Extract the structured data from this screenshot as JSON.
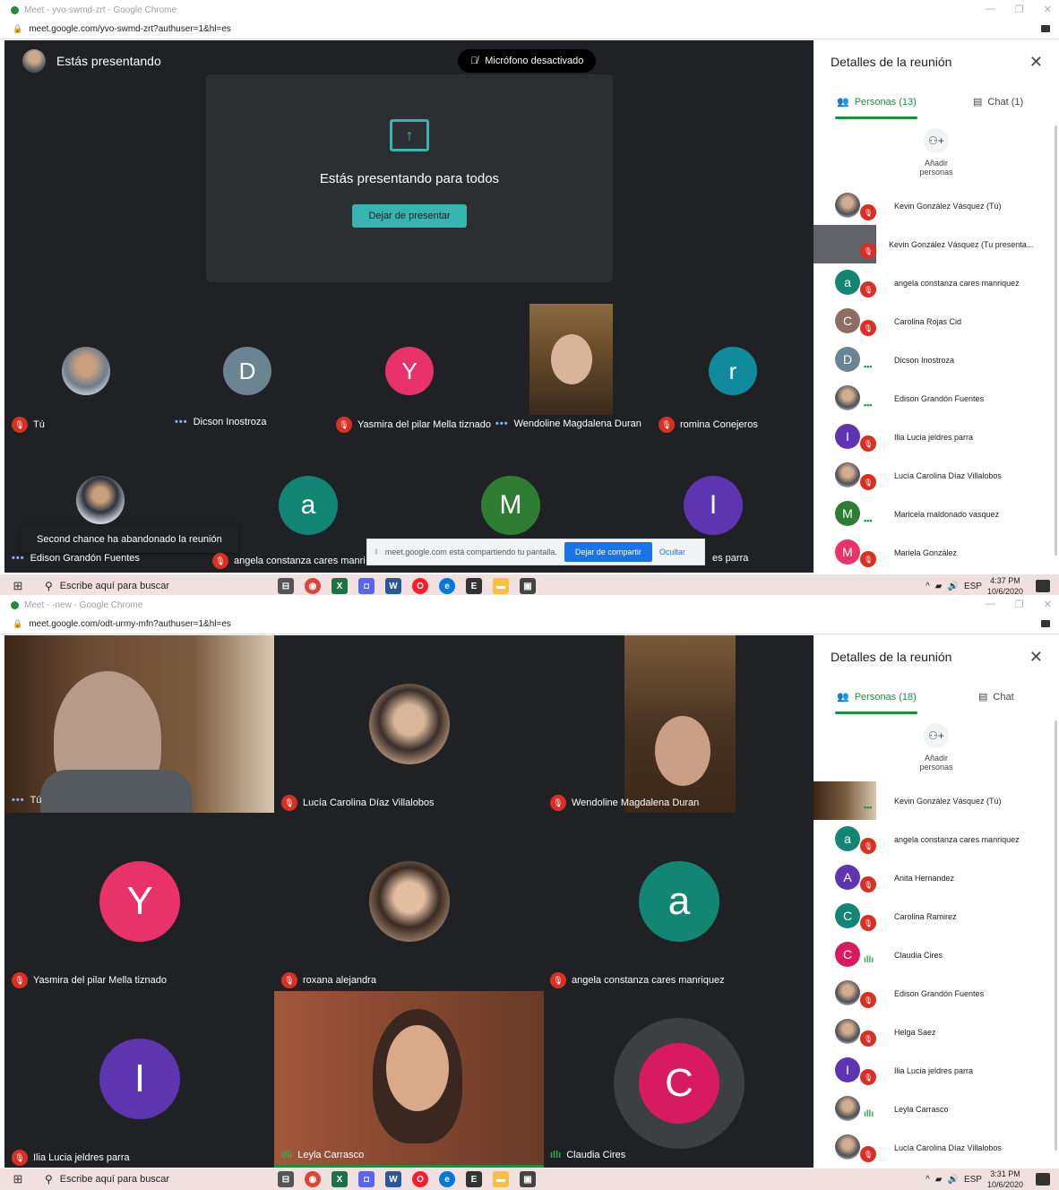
{
  "window1": {
    "title": "Meet - yvo-swmd-zrt - Google Chrome",
    "url": "meet.google.com/yvo-swmd-zrt?authuser=1&hl=es",
    "presenting_label": "Estás presentando",
    "mic_label": "Micrófono desactivado",
    "present_title": "Estás presentando para todos",
    "stop_button": "Dejar de presentar",
    "tiles": [
      {
        "name": "Tú",
        "status": "muted"
      },
      {
        "name": "Dicson Inostroza",
        "initial": "D",
        "color": "#6b8491",
        "status": "dots"
      },
      {
        "name": "Yasmira del pilar Mella tiznado",
        "initial": "Y",
        "color": "#e8336a",
        "status": "muted"
      },
      {
        "name": "Wendoline Magdalena Duran",
        "status": "dots"
      },
      {
        "name": "romina Conejeros",
        "initial": "r",
        "color": "#0f8b9c",
        "status": "muted"
      },
      {
        "name": "Edison Grandón Fuentes",
        "status": "dots"
      },
      {
        "name": "angela constanza cares manri",
        "initial": "a",
        "color": "#138673",
        "status": "muted"
      },
      {
        "name": "",
        "initial": "M",
        "color": "#2e7d32"
      },
      {
        "name": "es parra",
        "initial": "I",
        "color": "#5e35b1"
      }
    ],
    "toast": "Second chance ha abandonado la reunión",
    "sharebar": {
      "text": "meet.google.com está compartiendo tu pantalla.",
      "stop": "Dejar de compartir",
      "hide": "Ocultar"
    },
    "side": {
      "title": "Detalles de la reunión",
      "people_tab": "Personas (13)",
      "chat_tab": "Chat (1)",
      "add_label_1": "Añadir",
      "add_label_2": "personas",
      "people": [
        {
          "name": "Kevin González Vásquez (Tú)",
          "avatar": "photo",
          "status": "muted"
        },
        {
          "name": "Kevin González Vásquez (Tu presenta...",
          "avatar": "screen",
          "status": "muted"
        },
        {
          "name": "angela constanza cares manriquez",
          "initial": "a",
          "color": "#138673",
          "status": "muted"
        },
        {
          "name": "Carolina Rojas Cid",
          "initial": "C",
          "color": "#8d6e63",
          "status": "muted"
        },
        {
          "name": "Dicson Inostroza",
          "initial": "D",
          "color": "#6b8491",
          "status": "dots"
        },
        {
          "name": "Edison Grandón Fuentes",
          "avatar": "photo",
          "status": "dots"
        },
        {
          "name": "Ilia Lucia jeldres parra",
          "initial": "I",
          "color": "#5e35b1",
          "status": "muted"
        },
        {
          "name": "Lucía Carolina Díaz Villalobos",
          "avatar": "photo",
          "status": "muted"
        },
        {
          "name": "Maricela maldonado vasquez",
          "initial": "M",
          "color": "#2e7d32",
          "status": "dots"
        },
        {
          "name": "Mariela González",
          "initial": "M",
          "color": "#e8336a",
          "status": "muted"
        }
      ]
    },
    "taskbar": {
      "search": "Escribe aquí para buscar",
      "lang": "ESP",
      "time": "4:37 PM",
      "date": "10/6/2020"
    }
  },
  "window2": {
    "title": "Meet - -new - Google Chrome",
    "url": "meet.google.com/odt-urmy-mfn?authuser=1&hl=es",
    "tiles": [
      {
        "name": "Tú",
        "status": "dots"
      },
      {
        "name": "Lucía Carolina Díaz Villalobos",
        "status": "muted"
      },
      {
        "name": "Wendoline Magdalena Duran",
        "status": "muted"
      },
      {
        "name": "Yasmira del pilar Mella tiznado",
        "initial": "Y",
        "color": "#e8336a",
        "status": "muted"
      },
      {
        "name": "roxana alejandra",
        "status": "muted"
      },
      {
        "name": "angela constanza cares manriquez",
        "initial": "a",
        "color": "#138673",
        "status": "muted"
      },
      {
        "name": "Ilia Lucia jeldres parra",
        "initial": "I",
        "color": "#5e35b1",
        "status": "muted"
      },
      {
        "name": "Leyla Carrasco",
        "status": "bars"
      },
      {
        "name": "Claudia Cires",
        "initial": "C",
        "color": "#d81b60",
        "status": "bars"
      }
    ],
    "side": {
      "title": "Detalles de la reunión",
      "people_tab": "Personas (18)",
      "chat_tab": "Chat",
      "add_label_1": "Añadir",
      "add_label_2": "personas",
      "people": [
        {
          "name": "Kevin González Vásquez (Tú)",
          "avatar": "video",
          "status": "dots"
        },
        {
          "name": "angela constanza cares manriquez",
          "initial": "a",
          "color": "#138673",
          "status": "muted"
        },
        {
          "name": "Anita Hernandez",
          "initial": "A",
          "color": "#5e35b1",
          "status": "muted"
        },
        {
          "name": "Carolina Ramirez",
          "initial": "C",
          "color": "#138673",
          "status": "muted"
        },
        {
          "name": "Claudia Cires",
          "initial": "C",
          "color": "#d81b60",
          "status": "bars"
        },
        {
          "name": "Edison Grandón Fuentes",
          "avatar": "photo",
          "status": "muted"
        },
        {
          "name": "Helga Saez",
          "avatar": "photo",
          "status": "muted"
        },
        {
          "name": "Ilia Lucia jeldres parra",
          "initial": "I",
          "color": "#5e35b1",
          "status": "muted"
        },
        {
          "name": "Leyla Carrasco",
          "avatar": "photo",
          "status": "bars"
        },
        {
          "name": "Lucía Carolina Díaz Villalobos",
          "avatar": "photo",
          "status": "muted"
        }
      ]
    },
    "taskbar": {
      "search": "Escribe aquí para buscar",
      "lang": "ESP",
      "time": "3:31 PM",
      "date": "10/6/2020"
    }
  }
}
